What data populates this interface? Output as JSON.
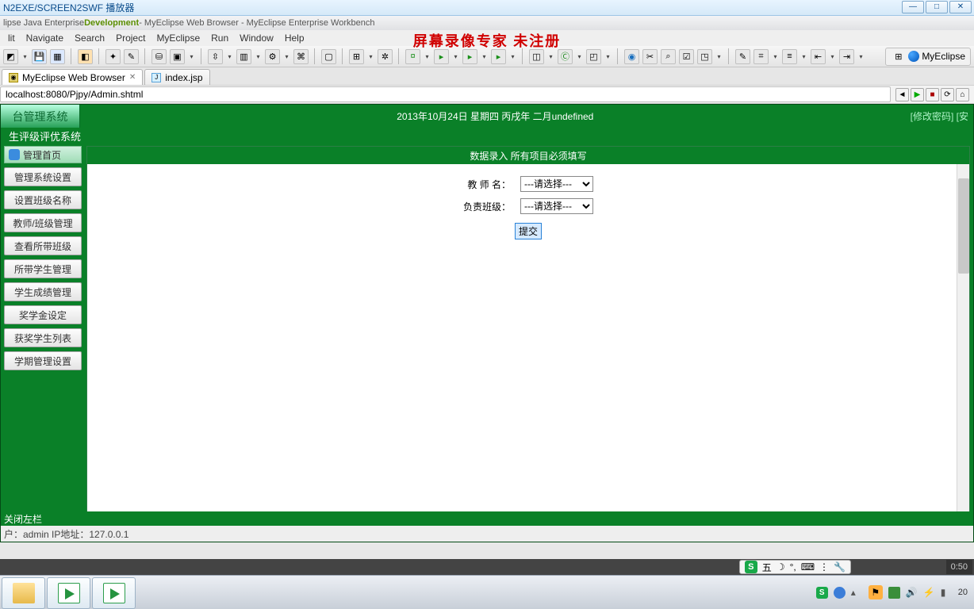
{
  "player": {
    "title": "N2EXE/SCREEN2SWF 播放器"
  },
  "eclipse": {
    "title_prefix": "lipse Java Enterprise ",
    "title_hl": "Development",
    "title_suffix": " - MyEclipse Web Browser - MyEclipse Enterprise Workbench"
  },
  "menu": {
    "items": [
      "lit",
      "Navigate",
      "Search",
      "Project",
      "MyEclipse",
      "Run",
      "Window",
      "Help"
    ]
  },
  "watermark": "屏幕录像专家  未注册",
  "perspective": "MyEclipse",
  "tabs": [
    {
      "label": "MyEclipse Web Browser",
      "active": true
    },
    {
      "label": "index.jsp",
      "active": false
    }
  ],
  "address": "localhost:8080/Pjpy/Admin.shtml",
  "green": {
    "logo": "台管理系统",
    "date": "2013年10月24日  星期四  丙戌年  二月undefined",
    "link_pwd": "[修改密码]",
    "link_safe": "[安",
    "subtitle": "生评级评优系统"
  },
  "sidebar": {
    "head": "管理首页",
    "items": [
      "管理系统设置",
      "设置班级名称",
      "教师/班级管理",
      "查看所带班级",
      "所带学生管理",
      "学生成绩管理",
      "奖学金设定",
      "获奖学生列表",
      "学期管理设置"
    ]
  },
  "form": {
    "header": "数据录入  所有项目必须填写",
    "row1_label": "教 师 名：",
    "row2_label": "负责班级：",
    "select_placeholder": "---请选择---",
    "submit": "提交"
  },
  "closebar": "关闭左栏",
  "status": "户：admin  IP地址：127.0.0.1",
  "ime": {
    "badge": "S",
    "items": [
      "五",
      "☽",
      "°,",
      "⌨",
      "⋮",
      "🔧"
    ]
  },
  "clock": "0:50",
  "tray_time": "20"
}
